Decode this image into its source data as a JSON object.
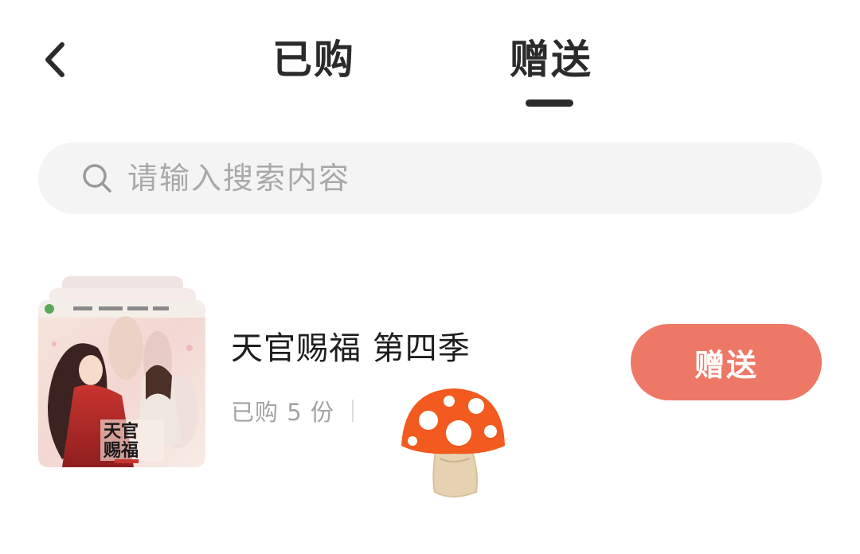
{
  "header": {
    "tabs": [
      {
        "label": "已购",
        "active": false
      },
      {
        "label": "赠送",
        "active": true
      }
    ]
  },
  "search": {
    "placeholder": "请输入搜索内容"
  },
  "items": [
    {
      "title": "天官赐福 第四季",
      "meta": "已购 5 份",
      "action_label": "赠送",
      "cover_text": "天官赐福"
    }
  ],
  "colors": {
    "accent": "#ee7866",
    "text_primary": "#1e1e1e",
    "text_secondary": "#a3a3a3",
    "search_bg": "#f4f4f4"
  },
  "icons": {
    "back": "chevron-left-icon",
    "search": "search-icon",
    "decoration": "mushroom-icon"
  }
}
